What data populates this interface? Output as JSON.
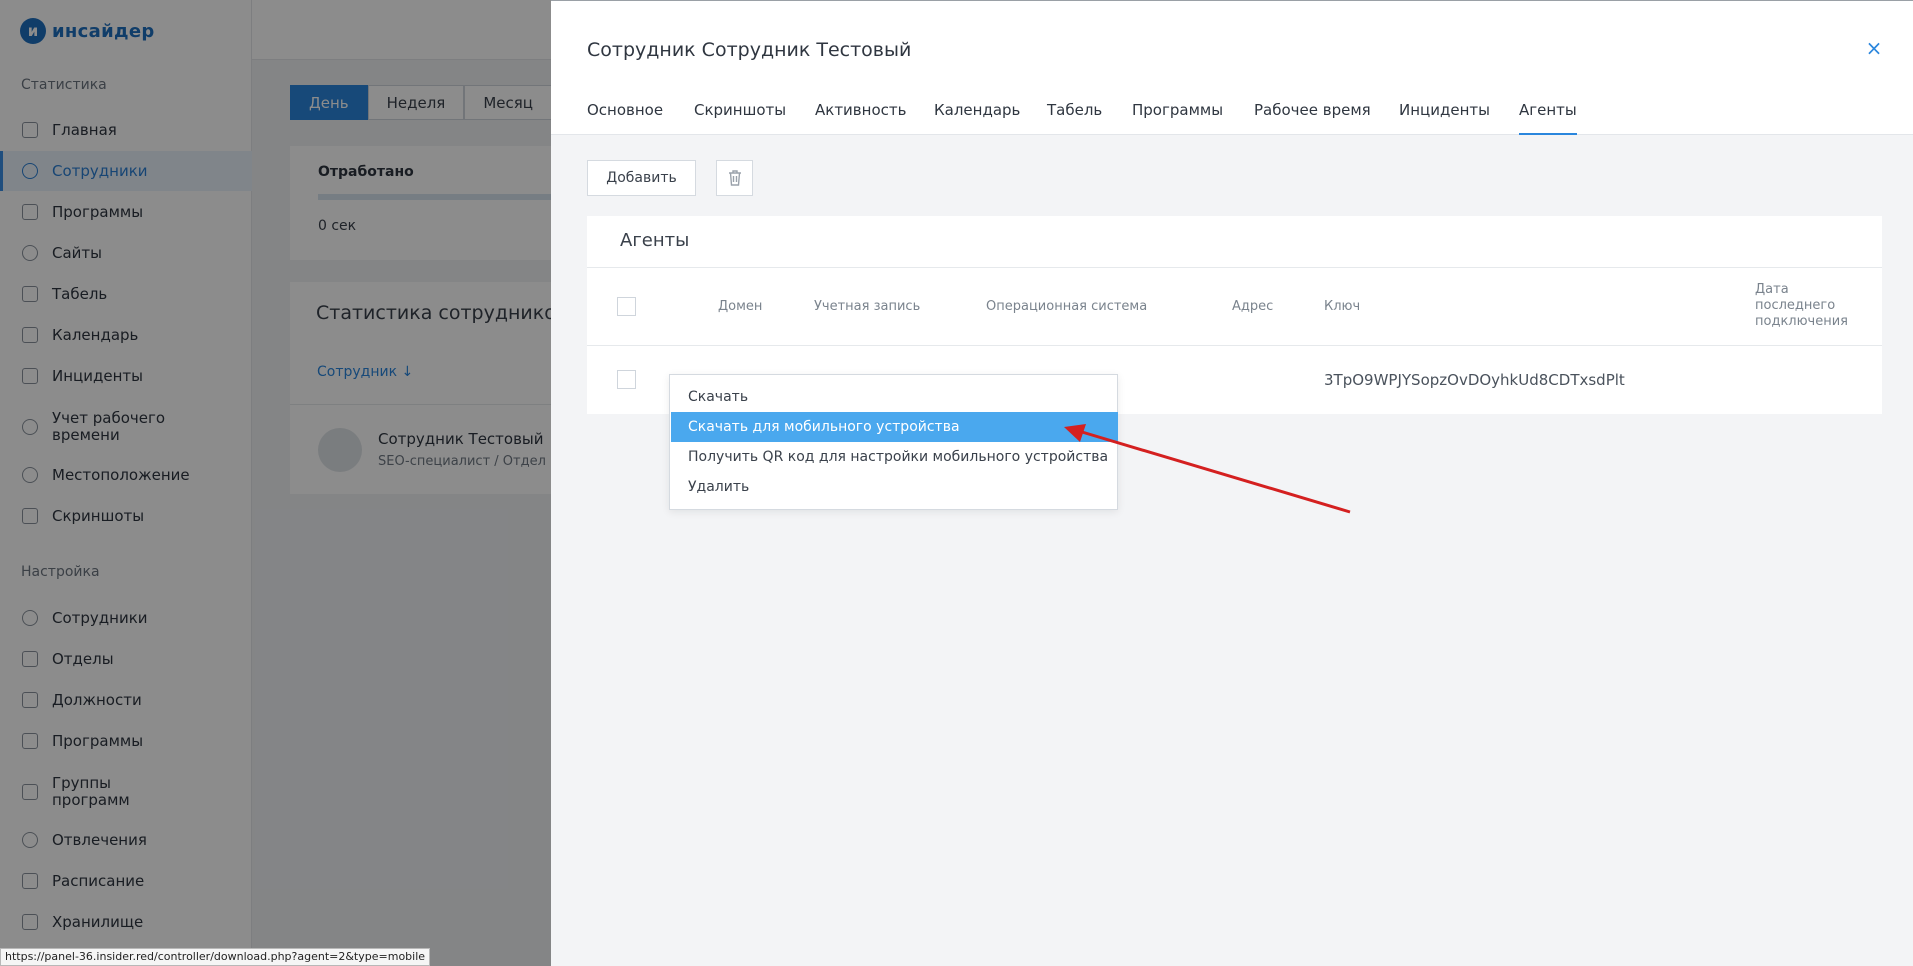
{
  "app": {
    "logo_mark": "и",
    "logo_text": "инсайдер"
  },
  "sidebar": {
    "section_stats": "Статистика",
    "stats_items": [
      {
        "label": "Главная",
        "icon": "grid-icon"
      },
      {
        "label": "Сотрудники",
        "icon": "user-icon",
        "active": true
      },
      {
        "label": "Программы",
        "icon": "list-icon"
      },
      {
        "label": "Сайты",
        "icon": "globe-icon"
      },
      {
        "label": "Табель",
        "icon": "table-icon"
      },
      {
        "label": "Календарь",
        "icon": "calendar-icon"
      },
      {
        "label": "Инциденты",
        "icon": "warning-icon"
      },
      {
        "label": "Учет рабочего\nвремени",
        "icon": "clock-icon"
      },
      {
        "label": "Местоположение",
        "icon": "location-icon"
      },
      {
        "label": "Скриншоты",
        "icon": "camera-icon"
      }
    ],
    "section_settings": "Настройка",
    "settings_items": [
      {
        "label": "Сотрудники",
        "icon": "user-icon"
      },
      {
        "label": "Отделы",
        "icon": "folder-icon"
      },
      {
        "label": "Должности",
        "icon": "id-card-icon"
      },
      {
        "label": "Программы",
        "icon": "list-icon"
      },
      {
        "label": "Группы\nпрограмм",
        "icon": "group-icon"
      },
      {
        "label": "Отвлечения",
        "icon": "clock-icon"
      },
      {
        "label": "Расписание",
        "icon": "calendar-icon"
      },
      {
        "label": "Хранилище",
        "icon": "storage-icon"
      }
    ]
  },
  "background": {
    "period_tabs": [
      "День",
      "Неделя",
      "Месяц"
    ],
    "worked_title": "Отработано",
    "worked_value": "0 сек",
    "stats_title": "Статистика сотрудников",
    "column_employee": "Сотрудник ↓",
    "employee_name": "Сотрудник Тестовый",
    "employee_sub": "SEO-специалист / Отдел"
  },
  "drawer": {
    "title": "Сотрудник Сотрудник Тестовый",
    "close_icon": "×",
    "tabs": [
      "Основное",
      "Скриншоты",
      "Активность",
      "Календарь",
      "Табель",
      "Программы",
      "Рабочее время",
      "Инциденты",
      "Агенты"
    ],
    "active_tab": "Агенты",
    "add_button": "Добавить",
    "agents": {
      "title": "Агенты",
      "columns": {
        "domain": "Домен",
        "account": "Учетная запись",
        "os": "Операционная система",
        "address": "Адрес",
        "key": "Ключ",
        "last_connection": "Дата\nпоследнего\nподключения"
      },
      "rows": [
        {
          "domain": "",
          "account": "",
          "os": "",
          "address": "",
          "key": "3TpO9WPJYSopzOvDOyhkUd8CDTxsdPlt",
          "last_connection": ""
        }
      ]
    }
  },
  "context_menu": {
    "items": [
      {
        "label": "Скачать"
      },
      {
        "label": "Скачать для мобильного устройства",
        "highlighted": true
      },
      {
        "label": "Получить QR код для настройки мобильного устройства"
      },
      {
        "label": "Удалить"
      }
    ]
  },
  "status_bar": {
    "url": "https://panel-36.insider.red/controller/download.php?agent=2&type=mobile"
  },
  "colors": {
    "accent": "#2a86dd",
    "menu_highlight": "#4aa8ee",
    "annotation_arrow": "#d42020"
  }
}
